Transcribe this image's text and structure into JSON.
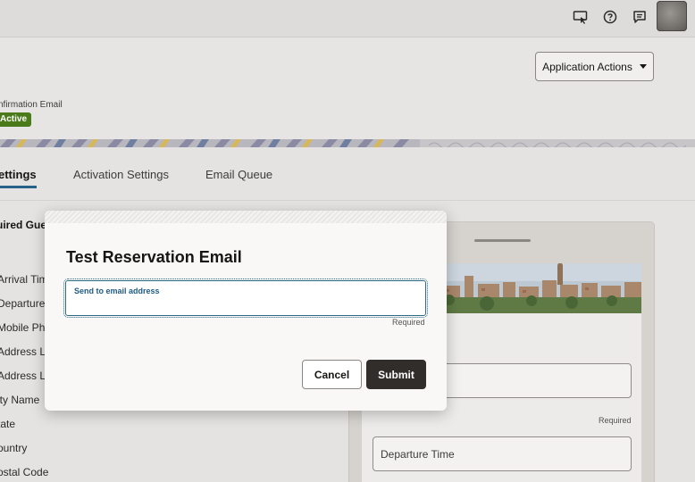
{
  "topbar": {
    "icons": [
      "ask-oracle-icon",
      "help-icon",
      "messages-icon"
    ]
  },
  "header": {
    "app_actions_label": "Application Actions",
    "subtitle": "nfirmation Email",
    "status_badge": "Active"
  },
  "tabs": [
    {
      "label": "ettings",
      "active": true
    },
    {
      "label": "Activation Settings",
      "active": false
    },
    {
      "label": "Email Queue",
      "active": false
    }
  ],
  "form": {
    "section_title": "uired Gue",
    "fields": [
      "Arrival Tim",
      "Departure",
      "Mobile Pho",
      "Address Li",
      "Address Li",
      "ity Name",
      "tate",
      "ountry",
      "ostal Code"
    ]
  },
  "preview": {
    "required_label": "Required",
    "departure_placeholder": "Departure Time"
  },
  "dialog": {
    "title": "Test Reservation Email",
    "email_label": "Send to email address",
    "email_value": "",
    "required_hint": "Required",
    "cancel_label": "Cancel",
    "submit_label": "Submit"
  },
  "colors": {
    "accent": "#266288",
    "badge_green": "#4a7a1a",
    "submit_dark": "#312d2a"
  }
}
